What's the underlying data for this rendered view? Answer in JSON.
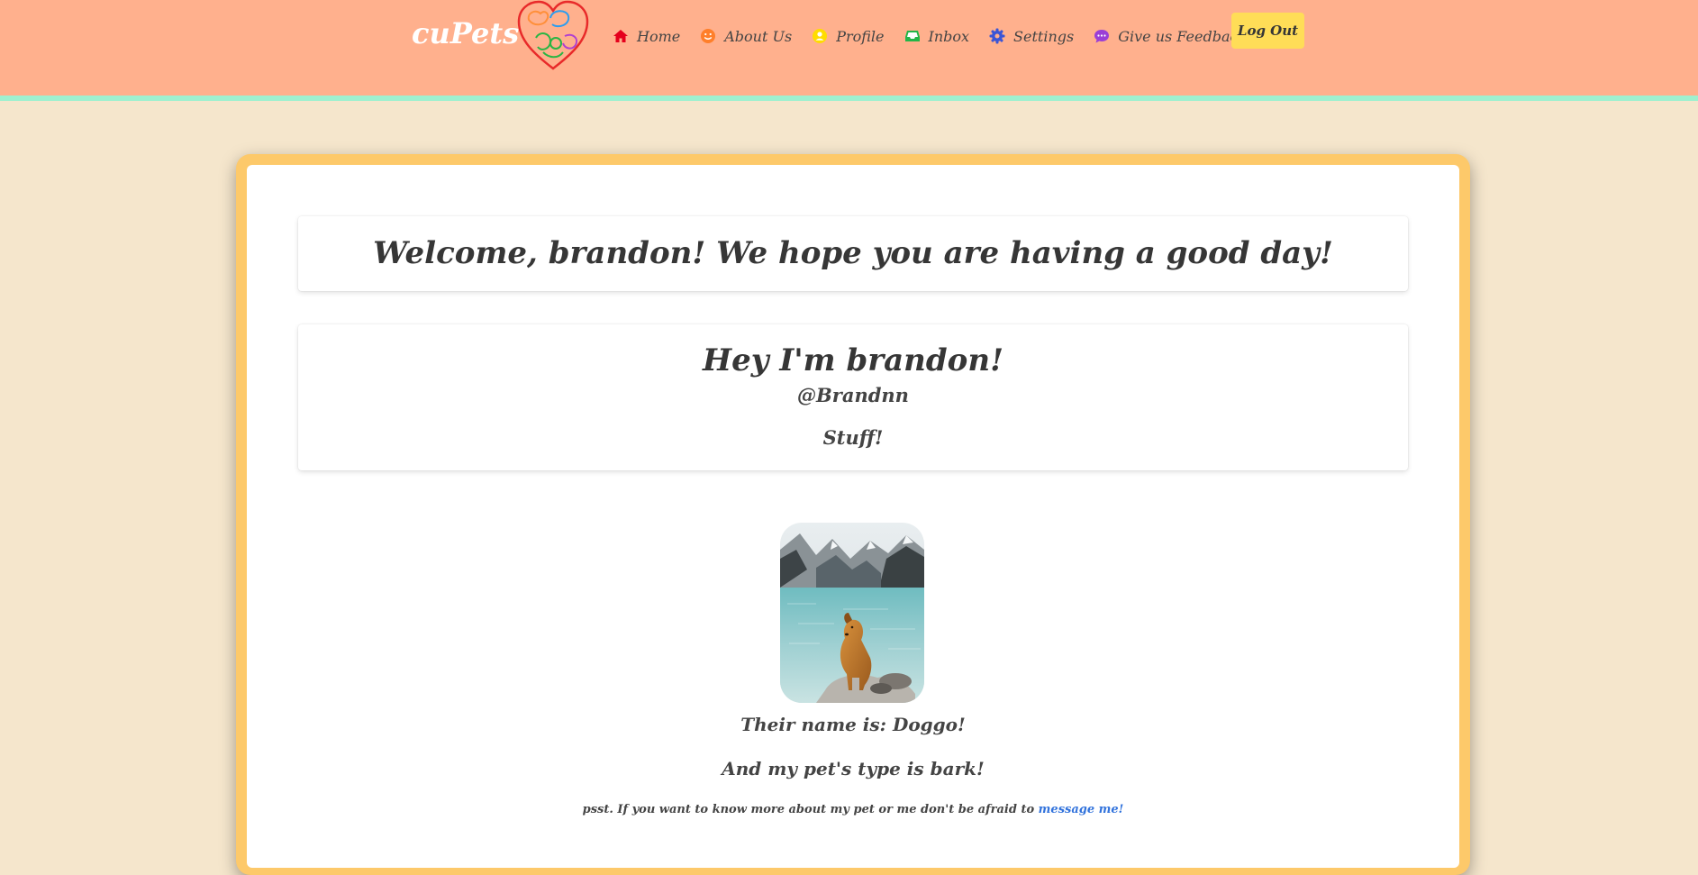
{
  "brand": "cuPets",
  "nav": {
    "items": [
      {
        "label": "Home",
        "icon": "home-icon",
        "color": "#e5001c"
      },
      {
        "label": "About Us",
        "icon": "smile-icon",
        "color": "#ff7f2a"
      },
      {
        "label": "Profile",
        "icon": "user-icon",
        "color": "#ffdd00"
      },
      {
        "label": "Inbox",
        "icon": "inbox-icon",
        "color": "#23b548"
      },
      {
        "label": "Settings",
        "icon": "gear-icon",
        "color": "#3b55d6"
      },
      {
        "label": "Give us Feedback",
        "icon": "comment-icon",
        "color": "#9b3fd6"
      }
    ],
    "logout_label": "Log Out"
  },
  "welcome": {
    "title": "Welcome, brandon! We hope you are having a good day!"
  },
  "profile": {
    "title": "Hey I'm brandon!",
    "handle": "@Brandnn",
    "bio": "Stuff!"
  },
  "pet": {
    "name_line": "Their name is: Doggo!",
    "type_line": "And my pet's type is bark!",
    "pssst_text": "psst. If you want to know more about my pet or me don't be afraid to ",
    "message_link": "message me!"
  },
  "colors": {
    "navbar": "#ffb08d",
    "navbar_border": "#9ff0cf",
    "page_bg": "#f5e6cc",
    "card_frame": "#fdc96a",
    "logout_button": "#ffdd57",
    "link": "#3273dc"
  }
}
